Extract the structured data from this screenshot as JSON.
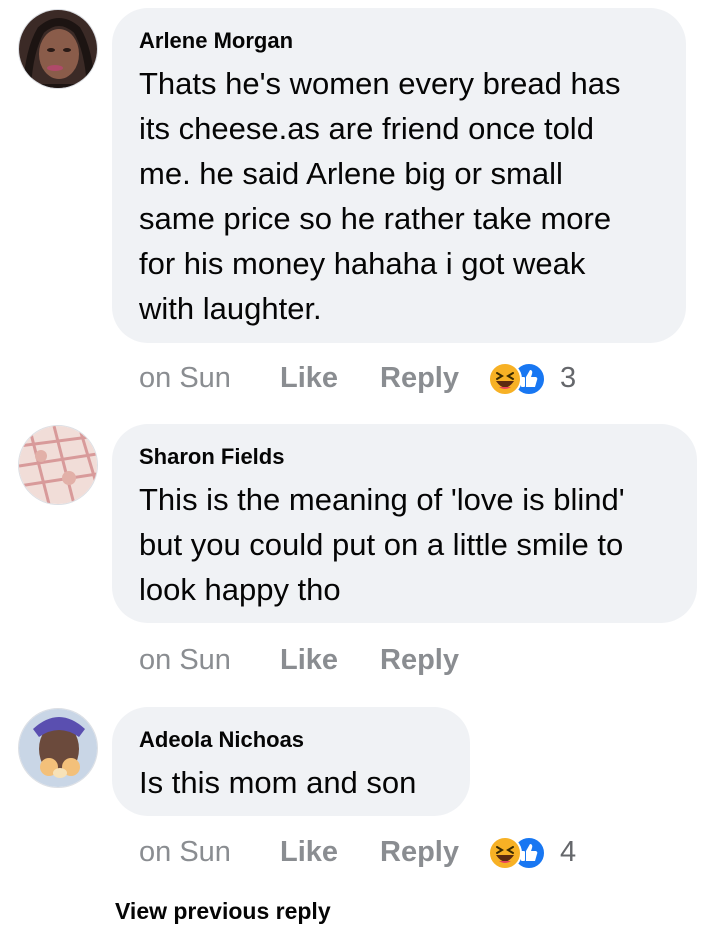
{
  "comments": [
    {
      "author": "Arlene Morgan",
      "text": "Thats he's women every bread has\nits cheese.as are friend once told\nme. he said Arlene big or small\nsame price so he rather take more\nfor his money hahaha i got weak\nwith laughter.",
      "time": "on Sun",
      "like_label": "Like",
      "reply_label": "Reply",
      "reaction_count": "3",
      "reaction_icons": [
        "haha-icon",
        "like-icon"
      ]
    },
    {
      "author": "Sharon Fields",
      "text": "This is the meaning of 'love is blind'\nbut you could put on a little smile to\nlook happy tho",
      "time": "on Sun",
      "like_label": "Like",
      "reply_label": "Reply"
    },
    {
      "author": "Adeola Nichoas",
      "text": "Is this mom and son",
      "time": "on Sun",
      "like_label": "Like",
      "reply_label": "Reply",
      "reaction_count": "4",
      "reaction_icons": [
        "haha-icon",
        "like-icon"
      ]
    }
  ],
  "view_previous_label": "View previous reply",
  "colors": {
    "bubble_bg": "#f0f2f5",
    "meta_text": "#8a8d91",
    "like_blue": "#1877f2",
    "haha_yellow": "#f7b125"
  }
}
